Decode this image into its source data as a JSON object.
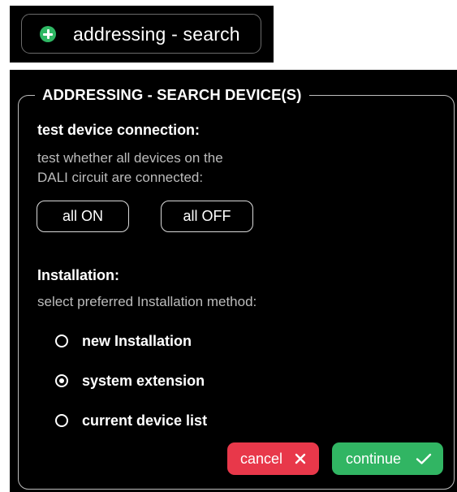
{
  "top_widget": {
    "label": "addressing - search",
    "icon": "plus-circle-icon",
    "icon_color": "#2fb864"
  },
  "dialog": {
    "title": "ADDRESSING - SEARCH DEVICE(S)",
    "connection": {
      "heading": "test device connection:",
      "description_line1": "test whether all devices on the",
      "description_line2": "DALI circuit are connected:",
      "all_on_label": "all ON",
      "all_off_label": "all OFF"
    },
    "installation": {
      "heading": "Installation:",
      "description": "select preferred Installation method:",
      "options": [
        {
          "label": "new Installation",
          "selected": false
        },
        {
          "label": "system extension",
          "selected": true
        },
        {
          "label": "current device list",
          "selected": false
        }
      ]
    },
    "actions": {
      "cancel_label": "cancel",
      "cancel_icon": "close-icon",
      "cancel_color": "#e8384a",
      "continue_label": "continue",
      "continue_icon": "checkmark-icon",
      "continue_color": "#31b563"
    }
  }
}
